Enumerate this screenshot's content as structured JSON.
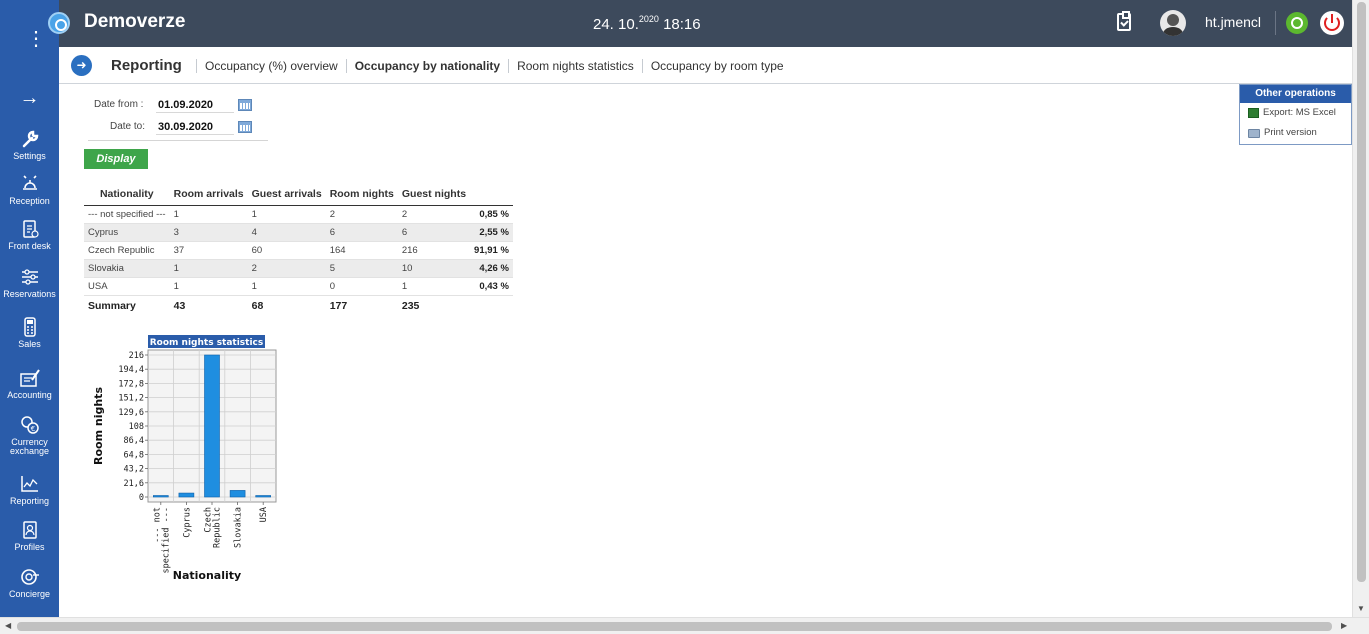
{
  "header": {
    "app_title": "Demoverze",
    "date": "24. 10.",
    "year": "2020",
    "time": "18:16",
    "username": "ht.jmencl"
  },
  "sidebar": {
    "items": [
      {
        "label": "Settings",
        "icon": "wrench-icon"
      },
      {
        "label": "Reception",
        "icon": "bell-icon"
      },
      {
        "label": "Front desk",
        "icon": "clipboard-icon"
      },
      {
        "label": "Reservations",
        "icon": "sliders-icon"
      },
      {
        "label": "Sales",
        "icon": "calculator-icon"
      },
      {
        "label": "Accounting",
        "icon": "ledger-icon"
      },
      {
        "label": "Currency exchange",
        "icon": "coins-icon"
      },
      {
        "label": "Reporting",
        "icon": "chart-icon"
      },
      {
        "label": "Profiles",
        "icon": "profile-icon"
      },
      {
        "label": "Concierge",
        "icon": "concierge-icon"
      }
    ]
  },
  "subheader": {
    "title": "Reporting",
    "tabs": [
      {
        "label": "Occupancy (%) overview",
        "active": false
      },
      {
        "label": "Occupancy by nationality",
        "active": true
      },
      {
        "label": "Room nights statistics",
        "active": false
      },
      {
        "label": "Occupancy by room type",
        "active": false
      }
    ]
  },
  "form": {
    "date_from_label": "Date from :",
    "date_from_value": "01.09.2020",
    "date_to_label": "Date to:",
    "date_to_value": "30.09.2020",
    "display_label": "Display"
  },
  "table": {
    "headers": [
      "Nationality",
      "Room arrivals",
      "Guest arrivals",
      "Room nights",
      "Guest nights",
      ""
    ],
    "rows": [
      [
        "--- not specified ---",
        "1",
        "1",
        "2",
        "2",
        "0,85 %"
      ],
      [
        "Cyprus",
        "3",
        "4",
        "6",
        "6",
        "2,55 %"
      ],
      [
        "Czech Republic",
        "37",
        "60",
        "164",
        "216",
        "91,91 %"
      ],
      [
        "Slovakia",
        "1",
        "2",
        "5",
        "10",
        "4,26 %"
      ],
      [
        "USA",
        "1",
        "1",
        "0",
        "1",
        "0,43 %"
      ]
    ],
    "summary": [
      "Summary",
      "43",
      "68",
      "177",
      "235",
      ""
    ]
  },
  "other_operations": {
    "title": "Other operations",
    "export_label": "Export: MS Excel",
    "print_label": "Print version"
  },
  "chart_data": {
    "type": "bar",
    "title": "Room nights statistics",
    "xlabel": "Nationality",
    "ylabel": "Room nights",
    "categories": [
      "--- not specified ---",
      "Cyprus",
      "Czech Republic",
      "Slovakia",
      "USA"
    ],
    "category_label_lines": [
      [
        "--- not",
        "specified ---"
      ],
      [
        "Cyprus"
      ],
      [
        "Czech",
        "Republic"
      ],
      [
        "Slovakia"
      ],
      [
        "USA"
      ]
    ],
    "values": [
      2,
      6,
      216,
      10,
      1
    ],
    "yticks": [
      "0",
      "21,6",
      "43,2",
      "64,8",
      "86,4",
      "108",
      "129,6",
      "151,2",
      "172,8",
      "194,4",
      "216"
    ],
    "ylim": [
      0,
      216
    ],
    "bar_color": "#1f8ee0"
  },
  "colors": {
    "topbar": "#3d4a5c",
    "sidebar": "#2a5caa",
    "display_button": "#3ea54a"
  }
}
